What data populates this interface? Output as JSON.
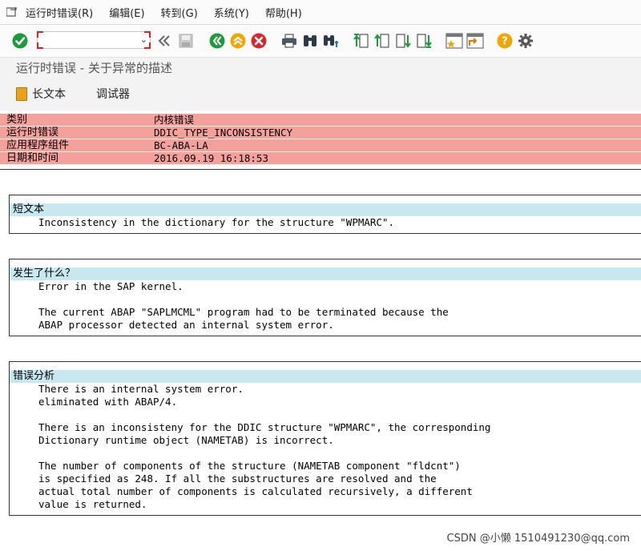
{
  "menu": {
    "items": [
      "运行时错误(R)",
      "编辑(E)",
      "转到(G)",
      "系统(Y)",
      "帮助(H)"
    ]
  },
  "toolbar": {
    "command_field": {
      "value": "",
      "placeholder": ""
    },
    "icons": [
      "enter-icon",
      "history-icon",
      "save-icon",
      "back-icon",
      "exit-icon",
      "cancel-icon",
      "print-icon",
      "find-icon",
      "find-next-icon",
      "first-page-icon",
      "previous-page-icon",
      "next-page-icon",
      "last-page-icon",
      "create-session-icon",
      "shortcut-icon",
      "help-icon",
      "customize-layout-icon"
    ]
  },
  "screen": {
    "title": "运行时错误 - 关于异常的描述"
  },
  "app_toolbar": {
    "long_text_label": "长文本",
    "debugger_label": "调试器"
  },
  "header": {
    "rows": [
      {
        "key": "类别",
        "value": "内核错误"
      },
      {
        "key": "运行时错误",
        "value": "DDIC_TYPE_INCONSISTENCY"
      },
      {
        "key": "应用程序组件",
        "value": "BC-ABA-LA"
      },
      {
        "key": "日期和时间",
        "value": "2016.09.19 16:18:53"
      }
    ]
  },
  "sections": [
    {
      "title": "短文本",
      "lines": [
        "Inconsistency in the dictionary for the structure \"WPMARC\"."
      ]
    },
    {
      "title": "发生了什么？",
      "lines": [
        "Error in the SAP kernel.",
        "",
        "The current ABAP \"SAPLMCML\" program had to be terminated because the",
        "ABAP processor detected an internal system error."
      ]
    },
    {
      "title": "错误分析",
      "lines": [
        "There is an internal system error.",
        "eliminated with ABAP/4.",
        "",
        "There is an inconsisteny for the DDIC structure \"WPMARC\", the corresponding",
        "Dictionary runtime object (NAMETAB) is incorrect.",
        "",
        "The number of components of the structure (NAMETAB component \"fldcnt\")",
        "is specified as 248. If all the substructures are resolved and the",
        "actual total number of components is calculated recursively, a different",
        "value is returned."
      ]
    }
  ],
  "watermark": "CSDN @小懒 1510491230@qq.com",
  "colors": {
    "header_row": "#f4a19c",
    "section_title": "#c7e8ef",
    "enter_green": "#1f9a3a",
    "exit_orange": "#f0a500",
    "cancel_red": "#d9262c",
    "help_yellow": "#f0a500"
  }
}
